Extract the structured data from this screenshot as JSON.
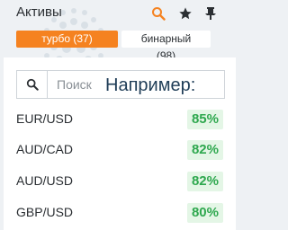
{
  "header": {
    "title": "Активы",
    "icons": [
      "search-icon",
      "star-icon",
      "pin-icon"
    ],
    "accent": "#f58220"
  },
  "tabs": [
    {
      "label": "турбо (37)",
      "active": true
    },
    {
      "label": "бинарный (98)",
      "active": false
    }
  ],
  "search": {
    "placeholder": "Поиск",
    "overlay_text": "Например:"
  },
  "assets": [
    {
      "name": "EUR/USD",
      "payout": "85%"
    },
    {
      "name": "AUD/CAD",
      "payout": "82%"
    },
    {
      "name": "AUD/USD",
      "payout": "82%"
    },
    {
      "name": "GBP/USD",
      "payout": "80%"
    }
  ],
  "colors": {
    "payout_text": "#2fa84f",
    "payout_bg": "#e4f6e6",
    "background": "#eef1f4"
  }
}
